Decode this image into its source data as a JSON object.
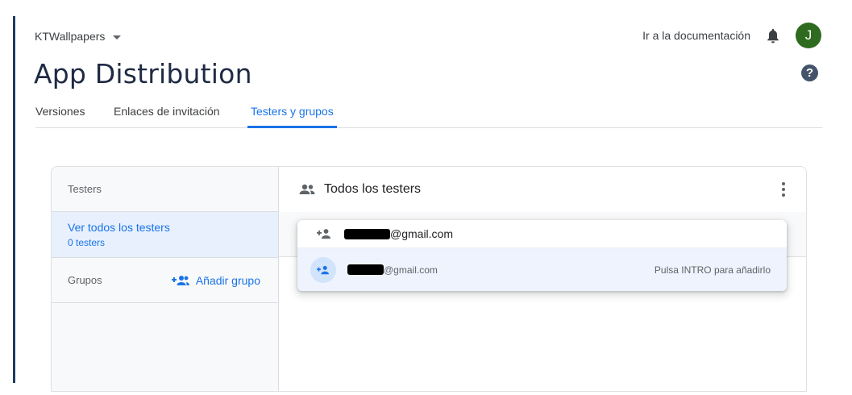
{
  "header": {
    "project_name": "KTWallpapers",
    "doc_link": "Ir a la documentación",
    "avatar_letter": "J",
    "page_title": "App Distribution",
    "help_glyph": "?"
  },
  "tabs": [
    {
      "label": "Versiones",
      "active": false
    },
    {
      "label": "Enlaces de invitación",
      "active": false
    },
    {
      "label": "Testers y grupos",
      "active": true
    }
  ],
  "left_panel": {
    "testers_heading": "Testers",
    "selected_title": "Ver todos los testers",
    "selected_sub": "0 testers",
    "groups_label": "Grupos",
    "add_group_label": "Añadir grupo"
  },
  "right_panel": {
    "title": "Todos los testers"
  },
  "dropdown": {
    "input_value_suffix": "@gmail.com",
    "suggestion_email_suffix": "@gmail.com",
    "suggestion_hint": "Pulsa INTRO para añadirlo"
  },
  "colors": {
    "accent": "#1a73e8",
    "avatar_bg": "#2e6b1f",
    "title": "#1f2a44"
  }
}
